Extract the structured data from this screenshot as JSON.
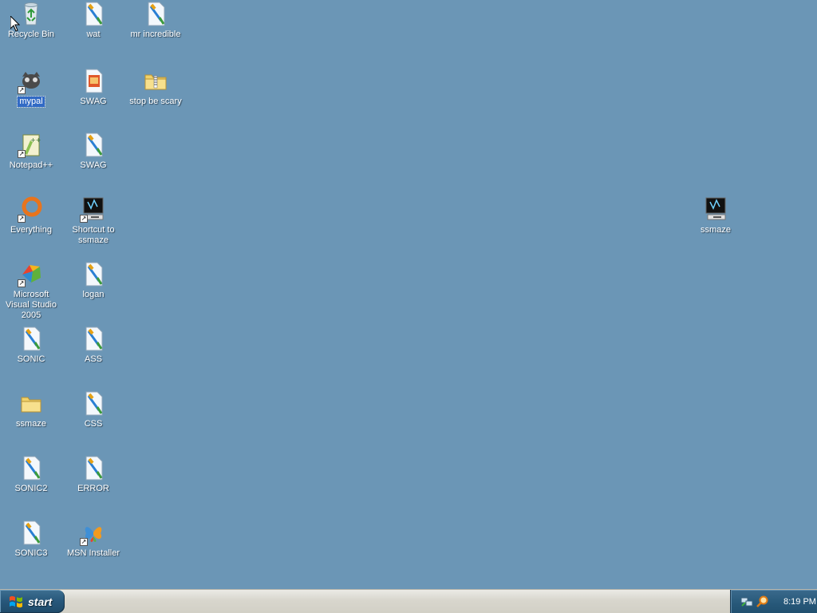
{
  "desktop": {
    "icons": [
      {
        "label": "Recycle Bin",
        "icon": "recycle-bin-icon"
      },
      {
        "label": "wat",
        "icon": "paint-document-icon"
      },
      {
        "label": "mr incredible",
        "icon": "paint-document-icon"
      },
      {
        "label": "mypal",
        "icon": "mypal-icon"
      },
      {
        "label": "SWAG",
        "icon": "image-document-icon"
      },
      {
        "label": "stop be scary",
        "icon": "zip-folder-icon"
      },
      {
        "label": "Notepad++",
        "icon": "notepad-plus-plus-icon"
      },
      {
        "label": "SWAG",
        "icon": "paint-document-icon"
      },
      {
        "label": "Everything",
        "icon": "everything-search-icon"
      },
      {
        "label": "Shortcut to ssmaze",
        "icon": "screensaver-icon"
      },
      {
        "label": "Microsoft Visual Studio 2005",
        "icon": "visual-studio-icon"
      },
      {
        "label": "logan",
        "icon": "paint-document-icon"
      },
      {
        "label": "SONIC",
        "icon": "paint-document-icon"
      },
      {
        "label": "ASS",
        "icon": "paint-document-icon"
      },
      {
        "label": "ssmaze",
        "icon": "folder-icon"
      },
      {
        "label": "CSS",
        "icon": "paint-document-icon"
      },
      {
        "label": "SONIC2",
        "icon": "paint-document-icon"
      },
      {
        "label": "ERROR",
        "icon": "paint-document-icon"
      },
      {
        "label": "SONIC3",
        "icon": "paint-document-icon"
      },
      {
        "label": "MSN Installer",
        "icon": "msn-butterfly-icon"
      },
      {
        "label": "ssmaze",
        "icon": "screensaver-icon"
      }
    ],
    "selected_icon": "mypal",
    "background_color": "#6b96b6"
  },
  "taskbar": {
    "start_label": "start",
    "clock": "8:19 PM",
    "tray_icons": [
      "network-icon",
      "search-magnifier-icon"
    ]
  }
}
